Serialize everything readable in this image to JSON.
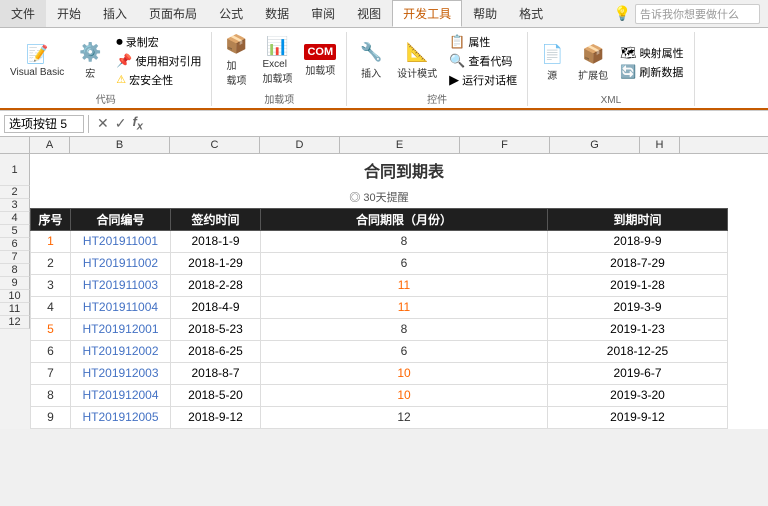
{
  "ribbon": {
    "tabs": [
      {
        "label": "文件",
        "active": false
      },
      {
        "label": "开始",
        "active": false
      },
      {
        "label": "插入",
        "active": false
      },
      {
        "label": "页面布局",
        "active": false
      },
      {
        "label": "公式",
        "active": false
      },
      {
        "label": "数据",
        "active": false
      },
      {
        "label": "审阅",
        "active": false
      },
      {
        "label": "视图",
        "active": false
      },
      {
        "label": "开发工具",
        "active": true
      },
      {
        "label": "帮助",
        "active": false
      },
      {
        "label": "格式",
        "active": false
      }
    ],
    "search_placeholder": "告诉我你想要做什么",
    "groups": {
      "code": {
        "label": "代码",
        "items": [
          "录制宏",
          "使用相对引用",
          "宏安全性",
          "Visual Basic",
          "宏"
        ]
      },
      "addins": {
        "label": "加载项",
        "items": [
          "加载项",
          "Excel 加载项",
          "COM 加载项"
        ]
      },
      "controls": {
        "label": "控件",
        "items": [
          "插入",
          "设计模式",
          "属性",
          "查看代码",
          "运行对话框"
        ]
      },
      "xml": {
        "label": "XML",
        "items": [
          "源",
          "扩展包",
          "映射属性",
          "刷新数据"
        ]
      }
    }
  },
  "formula_bar": {
    "name_box": "选项按钮 5",
    "formula": ""
  },
  "spreadsheet": {
    "col_headers": [
      "A",
      "B",
      "C",
      "D",
      "E",
      "F",
      "G",
      "H"
    ],
    "title": "合同到期表",
    "reminder": "◎ 30天提醒",
    "header_row": [
      "序号",
      "合同编号",
      "签约时间",
      "合同期限（月份）",
      "到期时间"
    ],
    "rows": [
      {
        "seq": "1",
        "contract": "HT201911001",
        "sign_date": "2018-1-9",
        "period": "8",
        "expire": "2018-9-9",
        "seq_color": "orange",
        "period_color": "normal",
        "expire_color": "normal"
      },
      {
        "seq": "2",
        "contract": "HT201911002",
        "sign_date": "2018-1-29",
        "period": "6",
        "expire": "2018-7-29",
        "seq_color": "normal",
        "period_color": "normal",
        "expire_color": "normal"
      },
      {
        "seq": "3",
        "contract": "HT201911003",
        "sign_date": "2018-2-28",
        "period": "11",
        "expire": "2019-1-28",
        "seq_color": "normal",
        "period_color": "orange",
        "expire_color": "normal"
      },
      {
        "seq": "4",
        "contract": "HT201911004",
        "sign_date": "2018-4-9",
        "period": "11",
        "expire": "2019-3-9",
        "seq_color": "normal",
        "period_color": "orange",
        "expire_color": "normal"
      },
      {
        "seq": "5",
        "contract": "HT201912001",
        "sign_date": "2018-5-23",
        "period": "8",
        "expire": "2019-1-23",
        "seq_color": "orange",
        "period_color": "normal",
        "expire_color": "normal"
      },
      {
        "seq": "6",
        "contract": "HT201912002",
        "sign_date": "2018-6-25",
        "period": "6",
        "expire": "2018-12-25",
        "seq_color": "normal",
        "period_color": "normal",
        "expire_color": "normal"
      },
      {
        "seq": "7",
        "contract": "HT201912003",
        "sign_date": "2018-8-7",
        "period": "10",
        "expire": "2019-6-7",
        "seq_color": "normal",
        "period_color": "orange",
        "expire_color": "normal"
      },
      {
        "seq": "8",
        "contract": "HT201912004",
        "sign_date": "2018-5-20",
        "period": "10",
        "expire": "2019-3-20",
        "seq_color": "normal",
        "period_color": "orange",
        "expire_color": "normal"
      },
      {
        "seq": "9",
        "contract": "HT201912005",
        "sign_date": "2018-9-12",
        "period": "12",
        "expire": "2019-9-12",
        "seq_color": "normal",
        "period_color": "normal",
        "expire_color": "normal"
      }
    ]
  }
}
